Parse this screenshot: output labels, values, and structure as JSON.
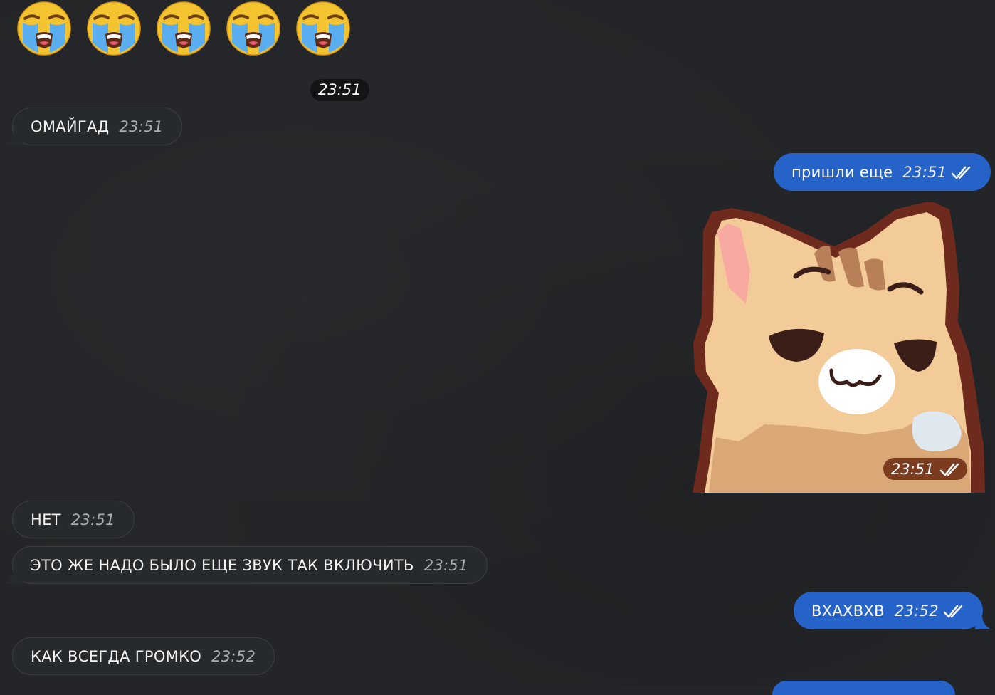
{
  "emojis": [
    "loudly-crying-face",
    "loudly-crying-face",
    "loudly-crying-face",
    "loudly-crying-face",
    "loudly-crying-face"
  ],
  "date_pill": "23:51",
  "messages": [
    {
      "dir": "in",
      "text": "ОМАЙГАД",
      "time": "23:51"
    },
    {
      "dir": "out",
      "text": "пришли еще",
      "time": "23:51",
      "status": "read"
    },
    {
      "dir": "in",
      "text": "НЕТ",
      "time": "23:51"
    },
    {
      "dir": "in",
      "text": "ЭТО ЖЕ НАДО БЫЛО ЕЩЕ ЗВУК ТАК ВКЛЮЧИТЬ",
      "time": "23:51"
    },
    {
      "dir": "out",
      "text": "ВХАХВХВ",
      "time": "23:52",
      "status": "read"
    },
    {
      "dir": "in",
      "text": "КАК ВСЕГДА ГРОМКО",
      "time": "23:52"
    }
  ],
  "sticker": {
    "subject": "smug-cat-sticker",
    "time": "23:51",
    "status": "read"
  },
  "colors": {
    "background": "#232528",
    "incoming_bubble": "#272a2d",
    "outgoing_bubble": "#2563c9",
    "sticker_time_bg": "#7a3b1e"
  }
}
